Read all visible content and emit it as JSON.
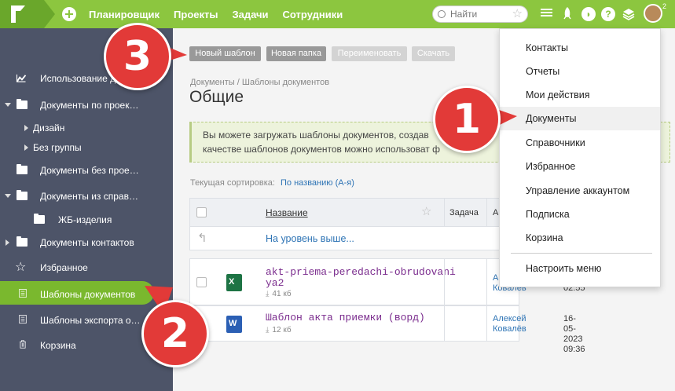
{
  "topbar": {
    "nav": [
      "Планировщик",
      "Проекты",
      "Задачи",
      "Сотрудники"
    ],
    "search_placeholder": "Найти",
    "notification_badge": "2",
    "icons": [
      "plus-icon",
      "star-icon",
      "menu-icon",
      "rocket-icon",
      "moon-icon",
      "help-icon",
      "layers-icon"
    ]
  },
  "sidebar": {
    "items": [
      {
        "label": "Использование ди",
        "icon": "chart-icon"
      },
      {
        "label": "Документы по проек…",
        "icon": "folder-open-icon"
      },
      {
        "label": "Дизайн",
        "icon": "caret-right-icon"
      },
      {
        "label": "Без группы",
        "icon": "caret-right-icon"
      },
      {
        "label": "Документы без прое…",
        "icon": "folder-icon"
      },
      {
        "label": "Документы из справ…",
        "icon": "folder-open-icon"
      },
      {
        "label": "ЖБ-изделия",
        "icon": "folder-icon"
      },
      {
        "label": "Документы контактов",
        "icon": "folder-icon"
      },
      {
        "label": "Избранное",
        "icon": "star-outline-icon"
      },
      {
        "label": "Шаблоны документов",
        "icon": "document-icon"
      },
      {
        "label": "Шаблоны экспорта о…",
        "icon": "document-icon"
      },
      {
        "label": "Корзина",
        "icon": "trash-icon"
      }
    ]
  },
  "toolbar": {
    "new_template": "Новый шаблон",
    "new_folder": "Новая папка",
    "rename": "Переименовать",
    "download": "Скачать"
  },
  "page": {
    "breadcrumb": "Документы / Шаблоны документов",
    "title": "Общие",
    "notice_line1": "Вы можете загружать шаблоны документов, создав",
    "notice_line2": "качестве шаблонов документов можно использоват",
    "notice_tail": "ф",
    "sort_label": "Текущая сортировка:",
    "sort_value": "По названию (А-я)"
  },
  "table": {
    "headers": {
      "name": "Название",
      "task": "Задача",
      "author": "А"
    },
    "up_level": "На уровень выше...",
    "rows": [
      {
        "name_line1": "akt-priema-peredachi-obrudovani",
        "name_line2": "ya2",
        "size": "41 кб",
        "type": "excel",
        "author_line1": "А",
        "author_line2": "Ковалев",
        "date_line1": "",
        "date_line2": "02:55"
      },
      {
        "name_line1": "Шаблон акта приемки (ворд)",
        "name_line2": "",
        "size": "12 кб",
        "type": "word",
        "author_line1": "Алексей",
        "author_line2": "Ковалёв",
        "date_line1": "16-05-2023",
        "date_line2": "09:36"
      }
    ]
  },
  "menu": {
    "items": [
      "Контакты",
      "Отчеты",
      "Мои действия",
      "Документы",
      "Справочники",
      "Избранное",
      "Управление аккаунтом",
      "Подписка",
      "Корзина",
      "Настроить меню"
    ]
  },
  "callouts": [
    "1",
    "2",
    "3"
  ],
  "colors": {
    "accent": "#8cc63f",
    "sidebar": "#4d5468",
    "callout": "#e23a38",
    "link": "#2e74b5",
    "file_link": "#7b2d8e"
  }
}
